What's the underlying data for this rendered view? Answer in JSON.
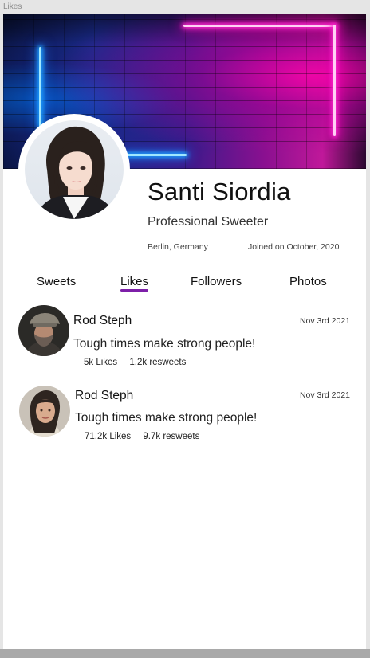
{
  "frame": {
    "label": "Likes"
  },
  "profile": {
    "name": "Santi Siordia",
    "bio": "Professional Sweeter",
    "location": "Berlin, Germany",
    "joined": "Joined on October, 2020"
  },
  "tabs": [
    {
      "label": "Sweets",
      "active": false
    },
    {
      "label": "Likes",
      "active": true
    },
    {
      "label": "Followers",
      "active": false
    },
    {
      "label": "Photos",
      "active": false
    }
  ],
  "posts": [
    {
      "author": "Rod Steph",
      "date": "Nov 3rd 2021",
      "text": "Tough times make strong people!",
      "likes": "5k Likes",
      "resweets": "1.2k resweets"
    },
    {
      "author": "Rod Steph",
      "date": "Nov 3rd 2021",
      "text": "Tough times make strong people!",
      "likes": "71.2k Likes",
      "resweets": "9.7k resweets"
    }
  ],
  "colors": {
    "accent": "#7d1fa8",
    "background": "#ffffff"
  }
}
